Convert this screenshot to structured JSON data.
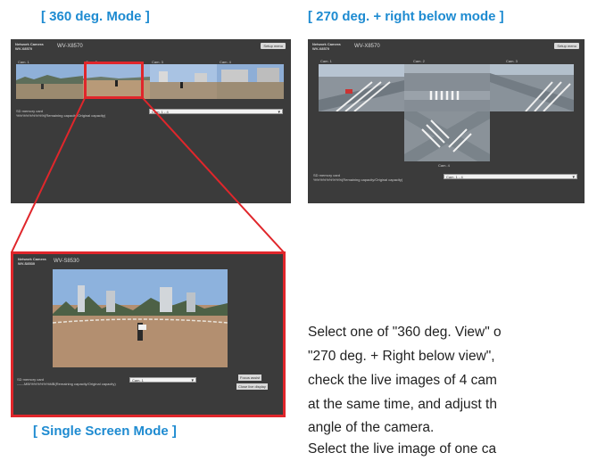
{
  "captions": {
    "mode360": "[ 360 deg. Mode ]",
    "mode270": "[ 270 deg. + right below mode ]",
    "single": "[ Single Screen Mode ]"
  },
  "panel360": {
    "brand": "Network Camera",
    "model_small": "WV-X8570",
    "model": "WV-X8570",
    "setup": "Setup menu",
    "cams": [
      "Cam. 1",
      "Cam. 2",
      "Cam. 3",
      "Cam. 4"
    ],
    "sd_label": "SD memory card",
    "sd_detail": "%%%%%%%%%(Remaining capacity/Original capacity)",
    "select": "Cam. 1 - 4"
  },
  "panel270": {
    "brand": "Network Camera",
    "model_small": "WV-X8570",
    "model": "WV-X8570",
    "setup": "Setup menu",
    "cams": [
      "Cam. 1",
      "Cam. 2",
      "Cam. 3",
      "Cam. 4"
    ],
    "sd_label": "SD memory card",
    "sd_detail": "%%%%%%%%%(Remaining capacity/Original capacity)",
    "select": "Cam. 1 - 4"
  },
  "panelSingle": {
    "brand": "Network Camera",
    "model_small": "WV-S8530",
    "model": "WV-S8530",
    "sd_label": "SD memory card",
    "sd_detail": "------MB/%%%%%%MB(Remaining capacity/Original capacity)",
    "select": "Cam. 1",
    "focus_btn": "Focus assist",
    "close_btn": "Close live display"
  },
  "description": [
    "Select one of \"360 deg. View\" o",
    "\"270 deg. + Right below view\",",
    "check the live images of 4 cam",
    "at the same time, and adjust th",
    "angle of the camera.",
    "Select the live image of one ca"
  ],
  "colors": {
    "caption": "#1e8bd1",
    "highlight": "#e0262b",
    "panel": "#3b3b3b"
  }
}
